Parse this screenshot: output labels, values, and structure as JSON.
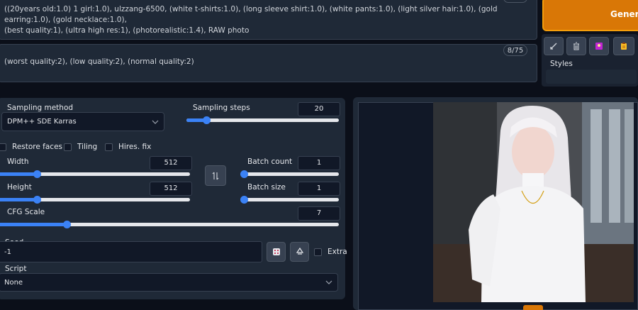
{
  "prompt": {
    "positive_text": "((20years old:1.0) 1 girl:1.0), ulzzang-6500, (white t-shirts:1.0), (long sleeve shirt:1.0), (white pants:1.0), (light silver hair:1.0), (gold earring:1.0), (gold necklace:1.0),\n(best quality:1), (ultra high res:1), (photorealistic:1.4), RAW photo",
    "negative_text": "(worst quality:2), (low quality:2), (normal quality:2)",
    "negative_token_count": "8/75"
  },
  "actions": {
    "generate_label": "Generate",
    "styles_label": "Styles"
  },
  "sampling": {
    "method_label": "Sampling method",
    "method_value": "DPM++ SDE Karras",
    "steps_label": "Sampling steps",
    "steps_value": "20",
    "steps_fraction": 0.13
  },
  "options": {
    "restore_faces": "Restore faces",
    "tiling": "Tiling",
    "hires_fix": "Hires. fix"
  },
  "dimensions": {
    "width_label": "Width",
    "width_value": "512",
    "width_fraction": 0.2,
    "height_label": "Height",
    "height_value": "512",
    "height_fraction": 0.2
  },
  "batch": {
    "count_label": "Batch count",
    "count_value": "1",
    "count_fraction": 0.0,
    "size_label": "Batch size",
    "size_value": "1",
    "size_fraction": 0.0
  },
  "cfg": {
    "label": "CFG Scale",
    "value": "7",
    "fraction": 0.2
  },
  "seed": {
    "label": "Seed",
    "value": "-1",
    "extra_label": "Extra"
  },
  "script": {
    "label": "Script",
    "value": "None"
  },
  "colors": {
    "accent": "#3b82f6",
    "generate": "#d97706",
    "background": "#0b0f19"
  }
}
